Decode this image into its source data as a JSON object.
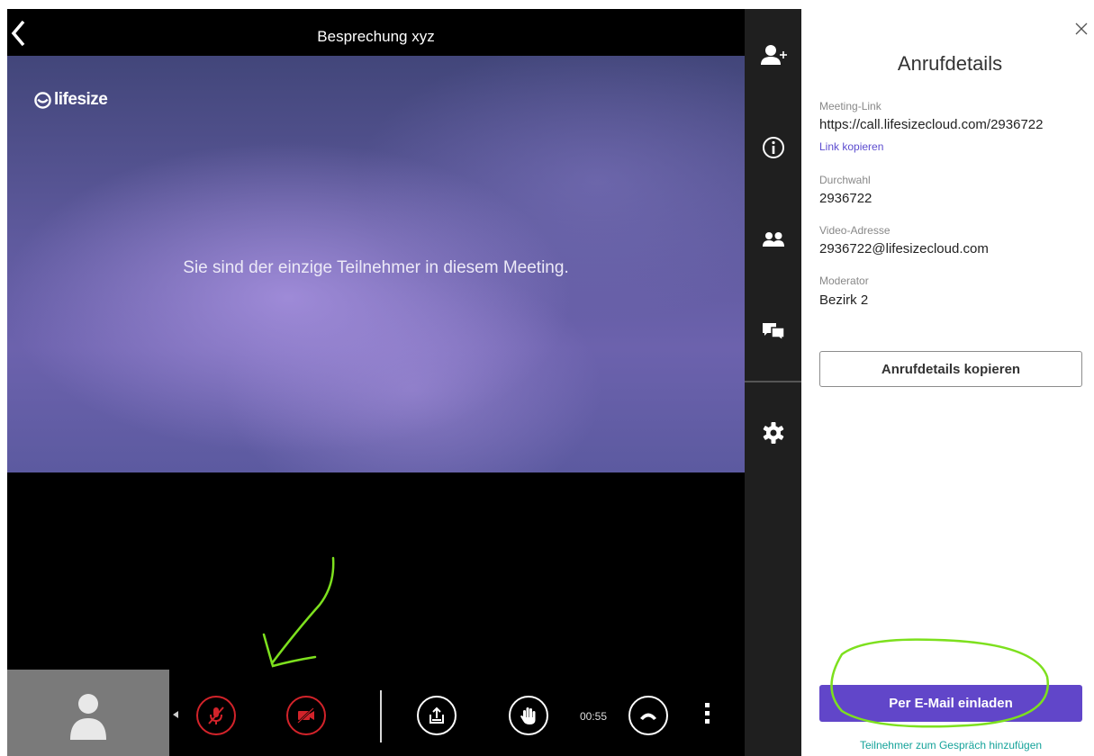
{
  "header": {
    "title": "Besprechung xyz"
  },
  "video": {
    "brand": "lifesize",
    "message": "Sie sind der einzige Teilnehmer in diesem Meeting."
  },
  "controls": {
    "timer": "00:55"
  },
  "panel": {
    "title": "Anrufdetails",
    "meeting_link_label": "Meeting-Link",
    "meeting_link_value": "https://call.lifesizecloud.com/2936722",
    "copy_link": "Link kopieren",
    "extension_label": "Durchwahl",
    "extension_value": "2936722",
    "video_address_label": "Video-Adresse",
    "video_address_value": "2936722@lifesizecloud.com",
    "moderator_label": "Moderator",
    "moderator_value": "Bezirk 2",
    "copy_details_button": "Anrufdetails kopieren",
    "email_invite_button": "Per E-Mail einladen",
    "add_participant_link": "Teilnehmer zum Gespräch hinzufügen"
  },
  "colors": {
    "accent": "#6146c9",
    "link": "#5c4ccf",
    "teal_link": "#15a39a",
    "muted_red": "#d2232a",
    "annotation_green": "#7de01e"
  },
  "icons": [
    "back-icon",
    "lifesize-logo-icon",
    "avatar-icon",
    "mic-off-icon",
    "camera-off-icon",
    "share-icon",
    "raise-hand-icon",
    "hang-up-icon",
    "more-icon",
    "add-person-icon",
    "info-icon",
    "participants-icon",
    "chat-icon",
    "settings-icon",
    "close-icon"
  ]
}
